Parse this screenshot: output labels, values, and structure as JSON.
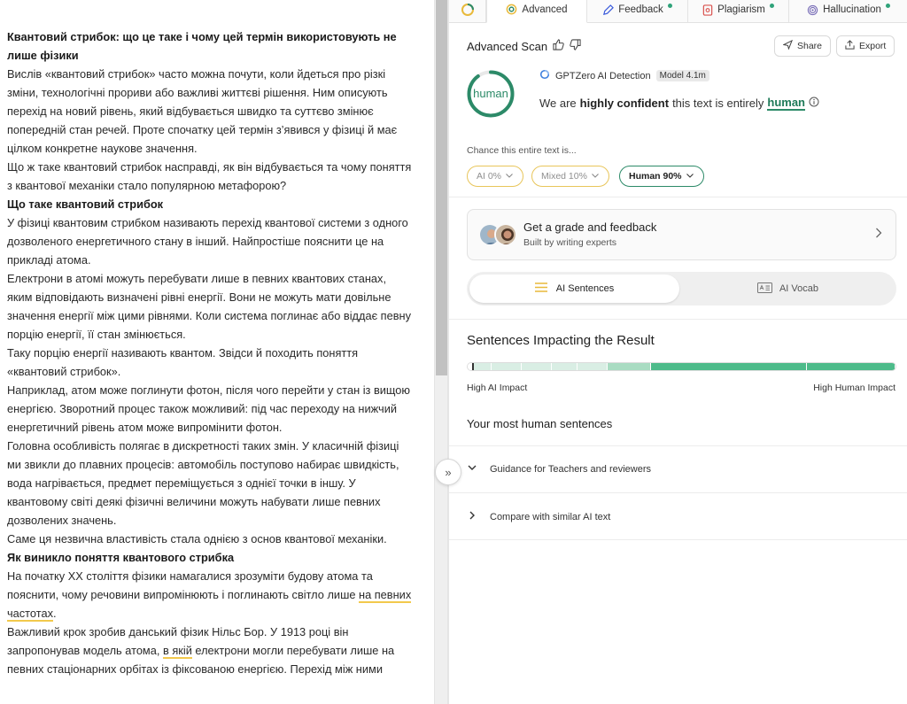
{
  "document": {
    "paragraphs": [
      {
        "bold": true,
        "text": "Квантовий стрибок: що це таке і чому цей термін використовують не лише фізики"
      },
      {
        "bold": false,
        "text": "Вислів «квантовий стрибок» часто можна почути, коли йдеться про різкі зміни, технологічні прориви або важливі життєві рішення. Ним описують перехід на новий рівень, який відбувається швидко та суттєво змінює попередній стан речей. Проте спочатку цей термін з’явився у фізиці й має цілком конкретне наукове значення."
      },
      {
        "bold": false,
        "text": "Що ж таке квантовий стрибок насправді, як він відбувається та чому поняття з квантової механіки стало популярною метафорою?"
      },
      {
        "bold": true,
        "text": "Що таке квантовий стрибок"
      },
      {
        "bold": false,
        "text": "У фізиці квантовим стрибком називають перехід квантової системи з одного дозволеного енергетичного стану в інший. Найпростіше пояснити це на прикладі атома."
      },
      {
        "bold": false,
        "text": "Електрони в атомі можуть перебувати лише в певних квантових станах, яким відповідають визначені рівні енергії. Вони не можуть мати довільне значення енергії між цими рівнями. Коли система поглинає або віддає певну порцію енергії, її стан змінюється."
      },
      {
        "bold": false,
        "text": "Таку порцію енергії називають квантом. Звідси й походить поняття «квантовий стрибок»."
      },
      {
        "bold": false,
        "text": "Наприклад, атом може поглинути фотон, після чого перейти у стан із вищою енергією. Зворотний процес також можливий: під час переходу на нижчий енергетичний рівень атом може випромінити фотон."
      },
      {
        "bold": false,
        "text": "Головна особливість полягає в дискретності таких змін. У класичній фізиці ми звикли до плавних процесів: автомобіль поступово набирає швидкість, вода нагрівається, предмет переміщується з однієї точки в іншу. У квантовому світі деякі фізичні величини можуть набувати лише певних дозволених значень."
      },
      {
        "bold": false,
        "text": "Саме ця незвична властивість стала однією з основ квантової механіки."
      },
      {
        "bold": true,
        "text": "Як виникло поняття квантового стрибка"
      },
      {
        "bold": false,
        "text": "На початку XX століття фізики намагалися зрозуміти будову атома та пояснити, чому речовини випромінюють і поглинають світло лише ",
        "underline": "на певних частотах",
        "after": "."
      },
      {
        "bold": false,
        "text": "Важливий крок зробив данський фізик Нільс Бор. У 1913 році він запропонував модель атома, ",
        "underline": "в якій",
        "after": " електрони могли перебувати лише на певних стаціонарних орбітах із фіксованою енергією. Перехід між ними"
      }
    ]
  },
  "tabs": [
    {
      "label": "",
      "icon": "gptzero-logo-icon"
    },
    {
      "label": "Advanced",
      "icon": "advanced-scan-icon",
      "active": true
    },
    {
      "label": "Feedback",
      "icon": "feedback-pen-icon",
      "dot": true
    },
    {
      "label": "Plagiarism",
      "icon": "plagiarism-doc-icon",
      "dot": true
    },
    {
      "label": "Hallucination",
      "icon": "hallucination-spiral-icon",
      "dot": true
    }
  ],
  "scan": {
    "title": "Advanced Scan",
    "share_label": "Share",
    "export_label": "Export",
    "ring_label": "human",
    "ring_fraction": 0.9,
    "detector_name": "GPTZero AI Detection",
    "model_badge": "Model 4.1m",
    "confidence_prefix": "We are",
    "confidence_strength": "highly confident",
    "confidence_middle": "this text is entirely",
    "confidence_result": "human",
    "chance_label": "Chance this entire text is...",
    "pills": {
      "ai": "AI 0%",
      "mixed": "Mixed 10%",
      "human": "Human 90%"
    }
  },
  "feedback_card": {
    "title": "Get a grade and feedback",
    "subtitle": "Built by writing experts"
  },
  "segmented": {
    "ai_sentences": "AI Sentences",
    "ai_vocab": "AI Vocab"
  },
  "impact": {
    "title": "Sentences Impacting the Result",
    "low_label": "High AI Impact",
    "high_label": "High Human Impact",
    "segments": [
      {
        "weight": 0.01,
        "color": "#ffffff"
      },
      {
        "weight": 0.04,
        "color": "#d9eee4"
      },
      {
        "weight": 0.07,
        "color": "#d9eee4"
      },
      {
        "weight": 0.07,
        "color": "#d9eee4"
      },
      {
        "weight": 0.06,
        "color": "#d9eee4"
      },
      {
        "weight": 0.07,
        "color": "#d9eee4"
      },
      {
        "weight": 0.1,
        "color": "#a9dcc2"
      },
      {
        "weight": 0.37,
        "color": "#4dbb8a"
      },
      {
        "weight": 0.21,
        "color": "#4dbb8a"
      }
    ]
  },
  "human_sentences_label": "Your most human sentences",
  "accordions": [
    {
      "label": "Guidance for Teachers and reviewers",
      "expanded": true
    },
    {
      "label": "Compare with similar AI text",
      "expanded": false
    }
  ],
  "colors": {
    "human_green": "#2c8a68",
    "ai_yellow": "#e8c55a",
    "status_dot": "#2fa37a"
  }
}
